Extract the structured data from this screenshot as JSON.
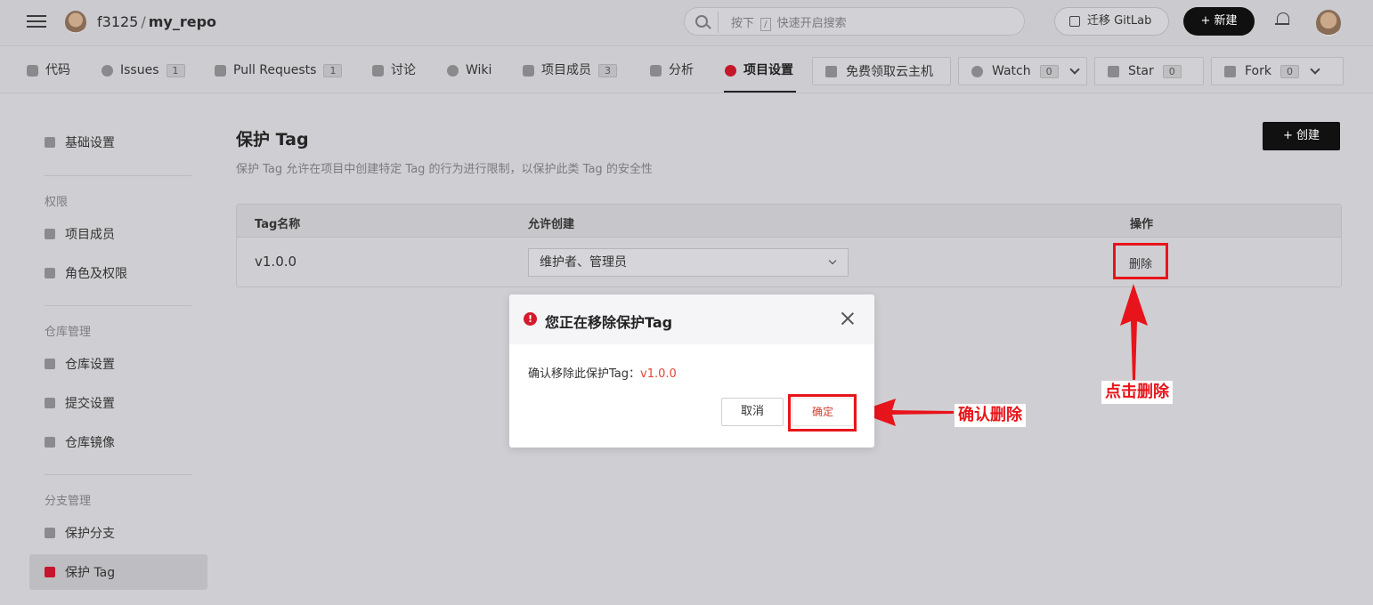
{
  "header": {
    "owner": "f3125",
    "separator": "/",
    "repo": "my_repo",
    "search": {
      "prefix": "按下",
      "key": "/",
      "suffix": "快速开启搜索"
    },
    "migrate_label": "迁移 GitLab",
    "new_label": "+ 新建"
  },
  "nav": {
    "tabs": [
      {
        "label": "代码"
      },
      {
        "label": "Issues",
        "badge": "1"
      },
      {
        "label": "Pull Requests",
        "badge": "1"
      },
      {
        "label": "讨论"
      },
      {
        "label": "Wiki"
      },
      {
        "label": "项目成员",
        "badge": "3"
      },
      {
        "label": "分析"
      },
      {
        "label": "项目设置",
        "active": true
      }
    ],
    "cloud_label": "免费领取云主机",
    "watch": {
      "label": "Watch",
      "count": "0"
    },
    "star": {
      "label": "Star",
      "count": "0"
    },
    "fork": {
      "label": "Fork",
      "count": "0"
    }
  },
  "sidebar": {
    "basic": "基础设置",
    "groups": [
      {
        "title": "权限",
        "items": [
          "项目成员",
          "角色及权限"
        ]
      },
      {
        "title": "仓库管理",
        "items": [
          "仓库设置",
          "提交设置",
          "仓库镜像"
        ]
      },
      {
        "title": "分支管理",
        "items": [
          "保护分支",
          "保护 Tag"
        ]
      }
    ],
    "active_item": "保护 Tag"
  },
  "main": {
    "title": "保护 Tag",
    "description": "保护 Tag 允许在项目中创建特定 Tag 的行为进行限制，以保护此类 Tag 的安全性",
    "create_label": "+ 创建",
    "table": {
      "columns": [
        "Tag名称",
        "允许创建",
        "操作"
      ],
      "rows": [
        {
          "name": "v1.0.0",
          "allow": "维护者、管理员",
          "action": "删除"
        }
      ]
    }
  },
  "modal": {
    "title": "您正在移除保护Tag",
    "message_prefix": "确认移除此保护Tag：",
    "tag": "v1.0.0",
    "cancel_label": "取消",
    "confirm_label": "确定"
  },
  "annotations": {
    "click_delete": "点击删除",
    "confirm_delete": "确认删除",
    "color": "#e8141b"
  }
}
